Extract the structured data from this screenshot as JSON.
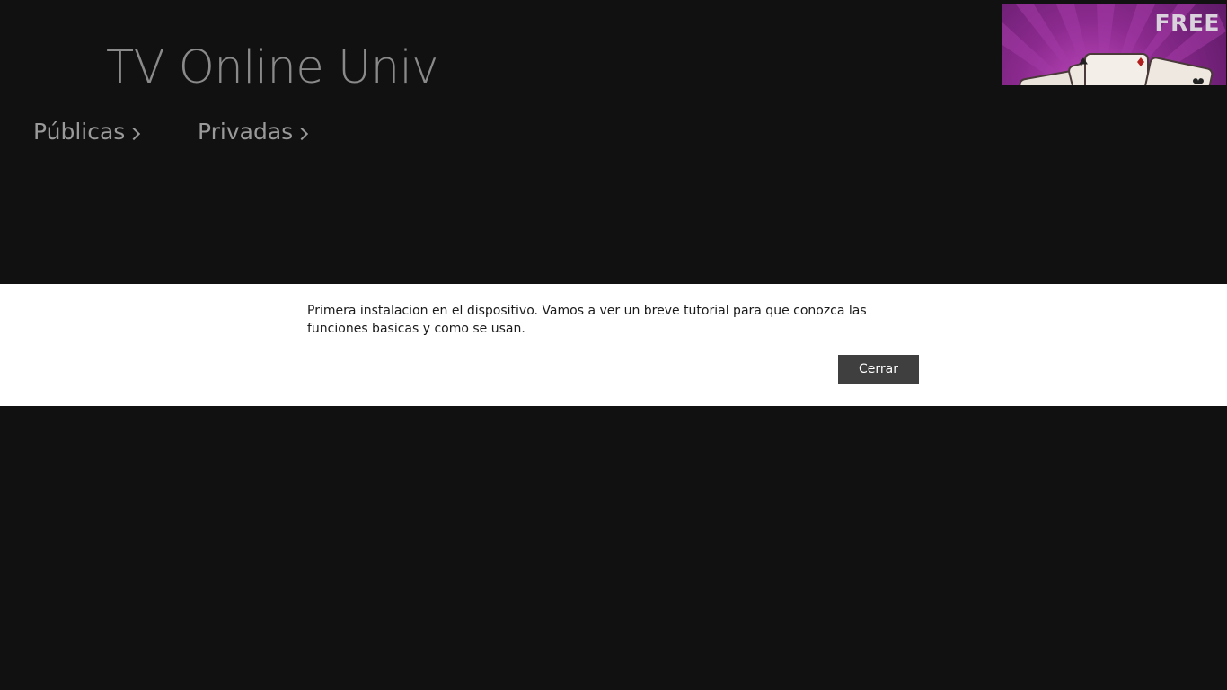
{
  "app": {
    "title": "TV Online Univ"
  },
  "nav": {
    "items": [
      {
        "label": "Públicas",
        "icon": "chevron-right-icon"
      },
      {
        "label": "Privadas",
        "icon": "chevron-right-icon"
      }
    ]
  },
  "ad": {
    "badge": "FREE",
    "image": "playing-cards-icon",
    "background_color": "#8c2a8f"
  },
  "dialog": {
    "message": "Primera instalacion en el dispositivo. Vamos a ver un breve tutorial para que conozca las funciones basicas y como se usan.",
    "close_label": "Cerrar",
    "button_color": "#3f3f3f"
  },
  "colors": {
    "background": "#111111",
    "dialog_background": "#ffffff"
  }
}
